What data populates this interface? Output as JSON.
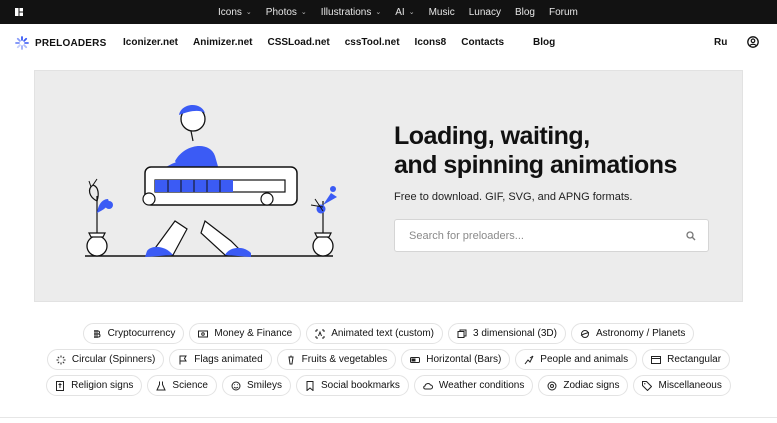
{
  "topnav": {
    "items": [
      {
        "label": "Icons",
        "dropdown": true
      },
      {
        "label": "Photos",
        "dropdown": true
      },
      {
        "label": "Illustrations",
        "dropdown": true
      },
      {
        "label": "AI",
        "dropdown": true
      },
      {
        "label": "Music",
        "dropdown": false
      },
      {
        "label": "Lunacy",
        "dropdown": false
      },
      {
        "label": "Blog",
        "dropdown": false
      },
      {
        "label": "Forum",
        "dropdown": false
      }
    ]
  },
  "header": {
    "brand": "PRELOADERS",
    "links": [
      "Iconizer.net",
      "Animizer.net",
      "CSSLoad.net",
      "cssTool.net",
      "Icons8",
      "Contacts"
    ],
    "blog": "Blog",
    "lang": "Ru"
  },
  "hero": {
    "title_line1": "Loading, waiting,",
    "title_line2": "and spinning animations",
    "subtitle": "Free to download. GIF, SVG, and APNG formats.",
    "search_placeholder": "Search for preloaders...",
    "progress": 0.6
  },
  "categories": {
    "row1": [
      {
        "label": "Cryptocurrency",
        "icon": "bitcoin-icon"
      },
      {
        "label": "Money & Finance",
        "icon": "money-icon"
      },
      {
        "label": "Animated text (custom)",
        "icon": "text-icon"
      },
      {
        "label": "3 dimensional (3D)",
        "icon": "cube-icon"
      },
      {
        "label": "Astronomy / Planets",
        "icon": "planet-icon"
      }
    ],
    "row2": [
      {
        "label": "Circular (Spinners)",
        "icon": "spinner-icon"
      },
      {
        "label": "Flags animated",
        "icon": "flag-icon"
      },
      {
        "label": "Fruits & vegetables",
        "icon": "fruit-icon"
      },
      {
        "label": "Horizontal (Bars)",
        "icon": "bar-icon"
      },
      {
        "label": "People and animals",
        "icon": "people-icon"
      },
      {
        "label": "Rectangular",
        "icon": "rectangle-icon"
      }
    ],
    "row3": [
      {
        "label": "Religion signs",
        "icon": "religion-icon"
      },
      {
        "label": "Science",
        "icon": "flask-icon"
      },
      {
        "label": "Smileys",
        "icon": "smiley-icon"
      },
      {
        "label": "Social bookmarks",
        "icon": "bookmark-icon"
      },
      {
        "label": "Weather conditions",
        "icon": "cloud-icon"
      },
      {
        "label": "Zodiac signs",
        "icon": "zodiac-icon"
      },
      {
        "label": "Miscellaneous",
        "icon": "tag-icon"
      }
    ]
  },
  "colors": {
    "accent": "#3b5bf5",
    "topbar": "#121212",
    "hero_bg": "#ececec"
  }
}
